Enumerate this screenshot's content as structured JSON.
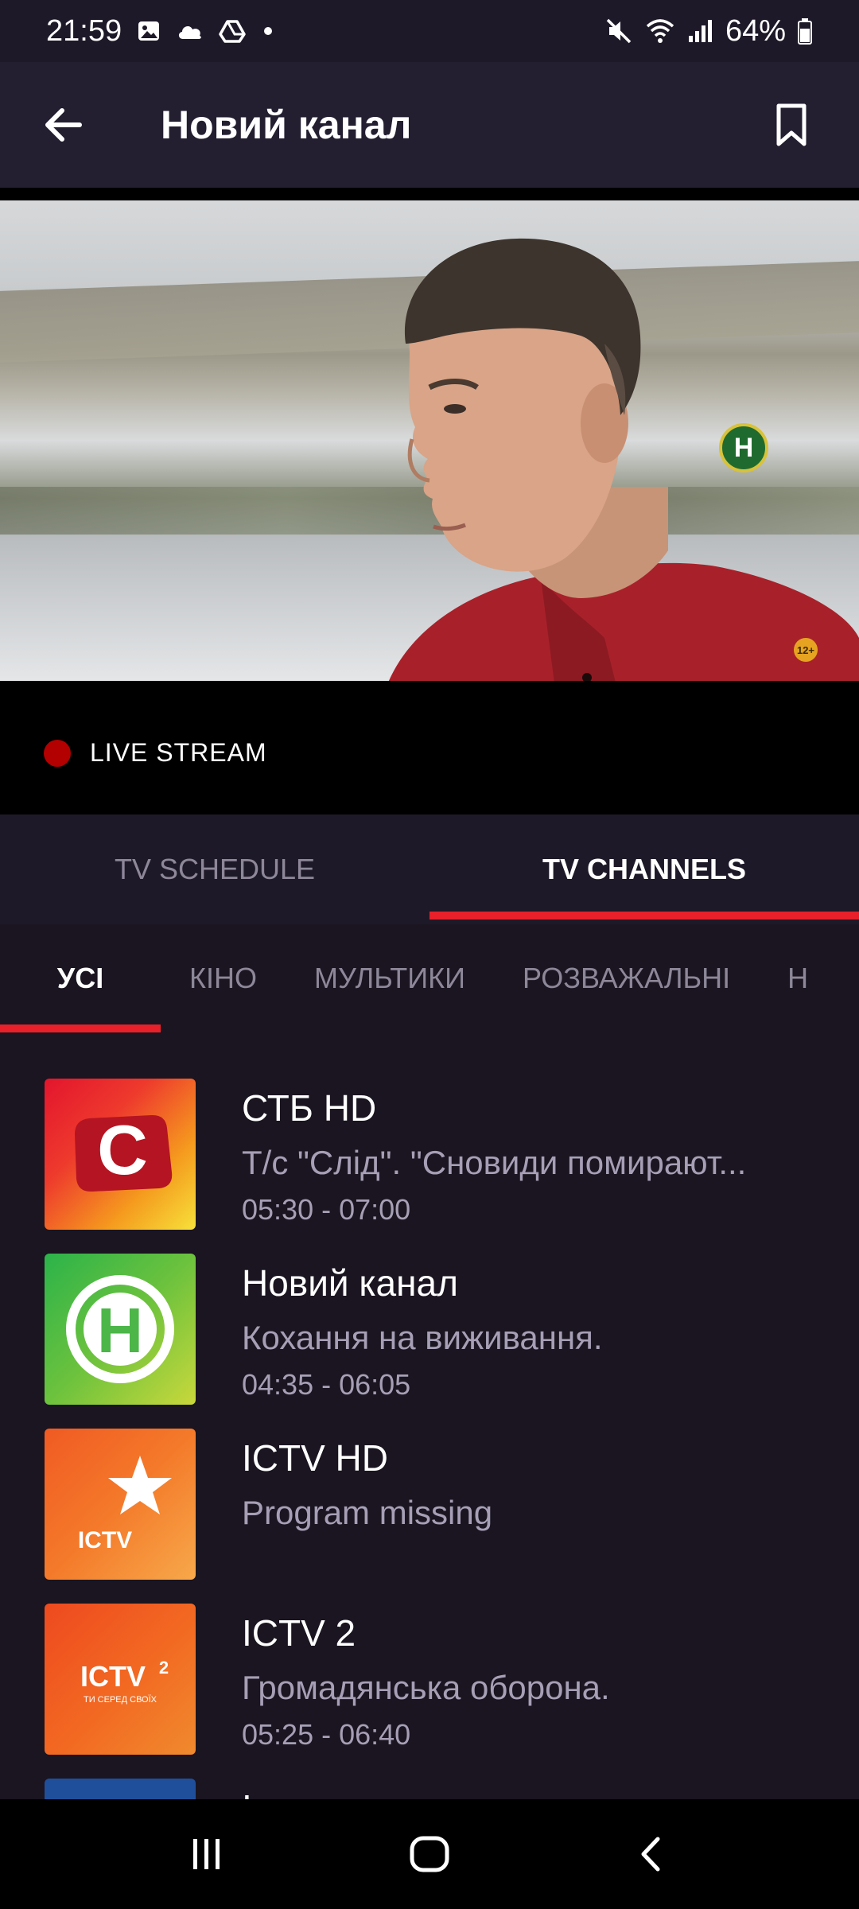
{
  "status_bar": {
    "time": "21:59",
    "battery": "64%",
    "icons": [
      "gallery-icon",
      "cloud-icon",
      "drive-icon",
      "dot-icon",
      "mute-icon",
      "wifi-icon",
      "signal-icon",
      "battery-icon"
    ]
  },
  "app_bar": {
    "title": "Новий канал",
    "back_icon": "arrow-left-icon",
    "bookmark_icon": "bookmark-icon"
  },
  "player": {
    "live_label": "LIVE STREAM",
    "watermark": "Н",
    "age_rating": "12+"
  },
  "main_tabs": [
    {
      "label": "TV SCHEDULE",
      "active": false
    },
    {
      "label": "TV CHANNELS",
      "active": true
    }
  ],
  "sub_tabs": [
    {
      "label": "УСІ",
      "active": true
    },
    {
      "label": "КІНО",
      "active": false
    },
    {
      "label": "МУЛЬТИКИ",
      "active": false
    },
    {
      "label": "РОЗВАЖАЛЬНІ",
      "active": false
    },
    {
      "label": "Н",
      "active": false
    }
  ],
  "channels": [
    {
      "name": "СТБ HD",
      "program": "Т/с \"Слід\". \"Сновиди помирают...",
      "time": "05:30 - 07:00",
      "logo_text": "С"
    },
    {
      "name": "Новий канал",
      "program": "Кохання на виживання.",
      "time": "04:35 - 06:05",
      "logo_text": "Н"
    },
    {
      "name": "ICTV HD",
      "program": "Program missing",
      "time": "",
      "logo_text": "ICTV"
    },
    {
      "name": "ICTV 2",
      "program": "Громадянська оборона.",
      "time": "05:25 - 06:40",
      "logo_text": "ICTV",
      "logo_sup": "2",
      "logo_sub": "ТИ СЕРЕД СВОЇХ"
    },
    {
      "name": "Інтер",
      "program": "",
      "time": "",
      "logo_text": ""
    }
  ],
  "nav_bar": {
    "icons": [
      "recent-apps-icon",
      "home-icon",
      "back-icon"
    ]
  },
  "colors": {
    "accent": "#e8202a",
    "background": "#1a1520",
    "app_bar": "#231e30",
    "secondary_text": "#a69fb5"
  }
}
